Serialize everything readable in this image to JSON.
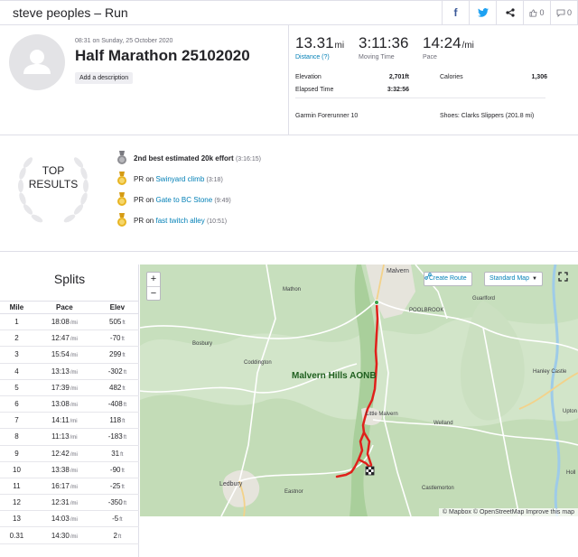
{
  "header": {
    "title": "steve peoples – Run",
    "kudos_count": "0",
    "comments_count": "0"
  },
  "activity": {
    "datetime": "08:31 on Sunday, 25 October 2020",
    "name": "Half Marathon 25102020",
    "add_description": "Add a description"
  },
  "stats": {
    "distance": {
      "value": "13.31",
      "unit": "mi",
      "label": "Distance (?)"
    },
    "moving_time": {
      "value": "3:11:36",
      "label": "Moving Time"
    },
    "pace": {
      "value": "14:24",
      "unit": "/mi",
      "label": "Pace"
    },
    "elevation_label": "Elevation",
    "elevation_value": "2,701ft",
    "calories_label": "Calories",
    "calories_value": "1,306",
    "elapsed_label": "Elapsed Time",
    "elapsed_value": "3:32:56",
    "device": "Garmin Forerunner 10",
    "shoes": "Shoes: Clarks Slippers (201.8 mi)"
  },
  "top_results": {
    "title_line1": "TOP",
    "title_line2": "RESULTS",
    "items": [
      {
        "medal": "silver",
        "prefix": "",
        "bold": "2nd best estimated 20k effort",
        "link": "",
        "time": "(3:16:15)"
      },
      {
        "medal": "gold",
        "prefix": "PR on ",
        "bold": "",
        "link": "Swinyard climb",
        "time": "(3:18)"
      },
      {
        "medal": "gold",
        "prefix": "PR on ",
        "bold": "",
        "link": "Gate to BC Stone",
        "time": "(9:49)"
      },
      {
        "medal": "gold",
        "prefix": "PR on ",
        "bold": "",
        "link": "fast twitch alley",
        "time": "(10:51)"
      }
    ]
  },
  "splits": {
    "title": "Splits",
    "headers": [
      "Mile",
      "Pace",
      "Elev"
    ],
    "pace_unit": "/mi",
    "elev_unit": "ft",
    "rows": [
      [
        "1",
        "18:08",
        "505"
      ],
      [
        "2",
        "12:47",
        "-70"
      ],
      [
        "3",
        "15:54",
        "299"
      ],
      [
        "4",
        "13:13",
        "-302"
      ],
      [
        "5",
        "17:39",
        "482"
      ],
      [
        "6",
        "13:08",
        "-408"
      ],
      [
        "7",
        "14:11",
        "118"
      ],
      [
        "8",
        "11:13",
        "-183"
      ],
      [
        "9",
        "12:42",
        "31"
      ],
      [
        "10",
        "13:38",
        "-90"
      ],
      [
        "11",
        "16:17",
        "-25"
      ],
      [
        "12",
        "12:31",
        "-350"
      ],
      [
        "13",
        "14:03",
        "-5"
      ],
      [
        "0.31",
        "14:30",
        "2"
      ]
    ]
  },
  "map": {
    "zoom_in": "+",
    "zoom_out": "−",
    "create_route": "Create Route",
    "map_style": "Standard Map",
    "attribution": "© Mapbox © OpenStreetMap Improve this map",
    "labels": {
      "malvern": "Malvern",
      "mathon": "Mathon",
      "guarlford": "Guarlford",
      "poolbrook": "POOLBROOK",
      "bosbury": "Bosbury",
      "coddington": "Coddington",
      "hanley_castle": "Hanley Castle",
      "aonb": "Malvern Hills AONB",
      "little_malvern": "Little Malvern",
      "welland": "Welland",
      "upton": "Upton",
      "ledbury": "Ledbury",
      "eastnor": "Eastnor",
      "castlemorton": "Castlemorton",
      "holly": "Holl"
    },
    "route_color": "#e0201b"
  }
}
